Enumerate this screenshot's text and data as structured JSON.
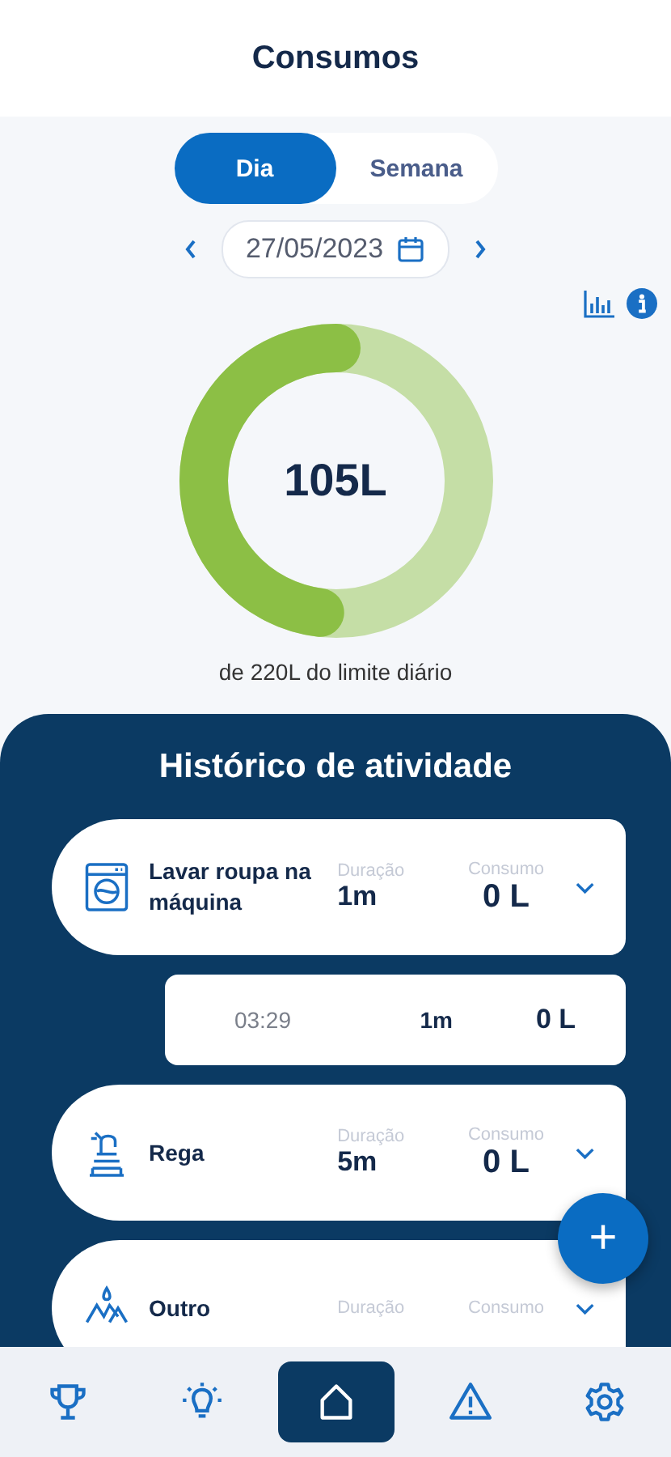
{
  "header": {
    "title": "Consumos"
  },
  "period_tabs": [
    {
      "label": "Dia",
      "selected": true
    },
    {
      "label": "Semana",
      "selected": false
    }
  ],
  "date": {
    "value": "27/05/2023"
  },
  "gauge": {
    "value": "105L",
    "level": 0.48,
    "caption": "de 220L do limite diário"
  },
  "history": {
    "title": "Histórico de atividade",
    "items": [
      {
        "kind": "washer",
        "name": "Lavar roupa na máquina",
        "duration_label": "Duração",
        "duration": "1m",
        "consumption_label": "Consumo",
        "consumption": "0 L",
        "expanded": true,
        "details": [
          {
            "time": "03:29",
            "duration": "1m",
            "consumption": "0 L"
          }
        ]
      },
      {
        "kind": "hose",
        "name": "Rega",
        "duration_label": "Duração",
        "duration": "5m",
        "consumption_label": "Consumo",
        "consumption": "0 L"
      },
      {
        "kind": "drops",
        "name": "Outro",
        "duration_label": "Duração",
        "consumption_label": "Consumo"
      }
    ]
  },
  "fab": {
    "label": "+"
  },
  "nav": [
    {
      "kind": "trophy",
      "selected": false
    },
    {
      "kind": "bulb",
      "selected": false
    },
    {
      "kind": "home",
      "selected": true
    },
    {
      "kind": "warning",
      "selected": false
    },
    {
      "kind": "gear",
      "selected": false
    }
  ]
}
